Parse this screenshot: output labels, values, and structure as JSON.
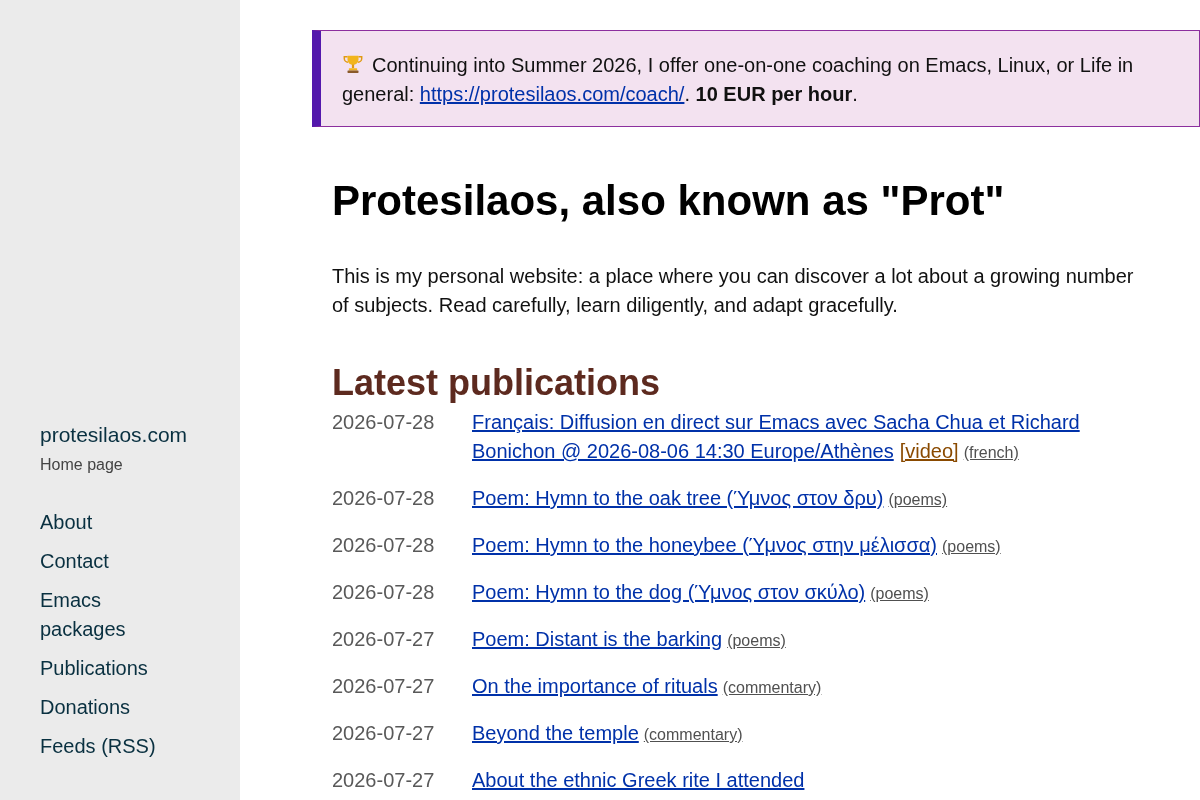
{
  "sidebar": {
    "site_name": "protesilaos.com",
    "subtitle": "Home page",
    "nav": [
      "About",
      "Contact",
      "Emacs packages",
      "Publications",
      "Donations",
      "Feeds (RSS)"
    ]
  },
  "notice": {
    "text_before": "Continuing into Summer 2026, I offer one-on-one coaching on Emacs, Linux, or Life in general: ",
    "link": "https://protesilaos.com/coach/",
    "text_after": ". **10 EUR per hour**."
  },
  "title": "Protesilaos, also known as \"Prot\"",
  "intro": "This is my personal website: a place where you can discover a lot about a growing number of subjects. Read carefully, learn diligently, and adapt gracefully.",
  "publications": {
    "heading": "Latest publications",
    "items": [
      {
        "date": "2026-07-28",
        "title_lines": [
          "Français: Diffusion en direct sur Emacs avec Sacha Chua et Richard",
          "Bonichon @ 2026-08-06 14:30 Europe/Athènes"
        ],
        "video": "[video]",
        "tag": "(french)"
      },
      {
        "date": "2026-07-28",
        "title_lines": [
          "Poem: Hymn to the oak tree (Ύμνος στον δρυ)"
        ],
        "tag": "(poems)"
      },
      {
        "date": "2026-07-28",
        "title_lines": [
          "Poem: Hymn to the honeybee (Ύμνος στην μέλισσα)"
        ],
        "tag": "(poems)"
      },
      {
        "date": "2026-07-28",
        "title_lines": [
          "Poem: Hymn to the dog (Ύμνος στον σκύλο)"
        ],
        "tag": "(poems)"
      },
      {
        "date": "2026-07-27",
        "title_lines": [
          "Poem: Distant is the barking"
        ],
        "tag": "(poems)"
      },
      {
        "date": "2026-07-27",
        "title_lines": [
          "On the importance of rituals"
        ],
        "tag": "(commentary)"
      },
      {
        "date": "2026-07-27",
        "title_lines": [
          "Beyond the temple"
        ],
        "tag": "(commentary)"
      },
      {
        "date": "2026-07-27",
        "title_lines": [
          "About the ethnic Greek rite I attended"
        ]
      }
    ]
  }
}
